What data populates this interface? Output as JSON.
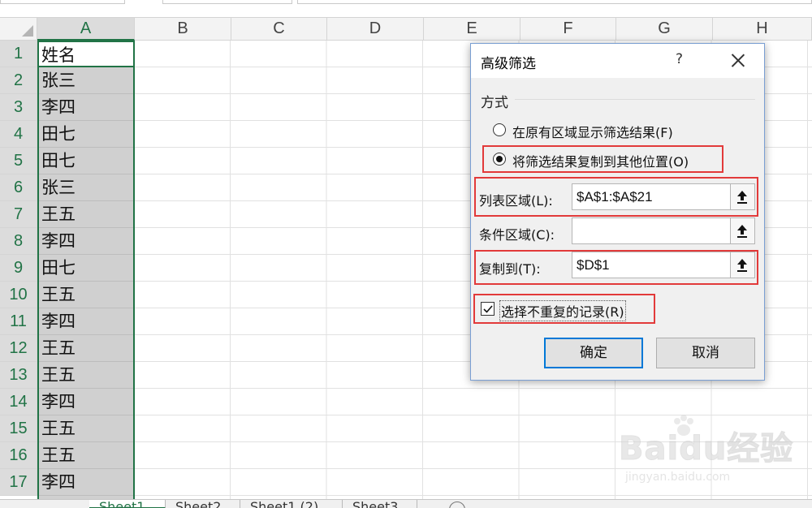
{
  "spreadsheet": {
    "columns": [
      "A",
      "B",
      "C",
      "D",
      "E",
      "F",
      "G",
      "H"
    ],
    "rows": [
      "1",
      "2",
      "3",
      "4",
      "5",
      "6",
      "7",
      "8",
      "9",
      "10",
      "11",
      "12",
      "13",
      "14",
      "15",
      "16",
      "17"
    ],
    "colA_values": [
      "姓名",
      "张三",
      "李四",
      "田七",
      "田七",
      "张三",
      "王五",
      "李四",
      "田七",
      "王五",
      "李四",
      "王五",
      "王五",
      "李四",
      "王五",
      "王五",
      "李四"
    ]
  },
  "sheet_tabs": [
    "Sheet1",
    "Sheet2",
    "Sheet1 (2)",
    "Sheet3"
  ],
  "dialog": {
    "title": "高级筛选",
    "help": "?",
    "group_label": "方式",
    "option_in_place": "在原有区域显示筛选结果(F)",
    "option_copy": "将筛选结果复制到其他位置(O)",
    "selected_option": "option_copy",
    "list_range_label": "列表区域(L):",
    "list_range_value": "$A$1:$A$21",
    "criteria_range_label": "条件区域(C):",
    "criteria_range_value": "",
    "copy_to_label": "复制到(T):",
    "copy_to_value": "$D$1",
    "unique_label": "选择不重复的记录(R)",
    "unique_checked": true,
    "ok_label": "确定",
    "cancel_label": "取消"
  },
  "watermark": {
    "brand": "Baidu经验",
    "url": "jingyan.baidu.com"
  },
  "colors": {
    "excel_green": "#217346",
    "highlight_red": "#e23a3a",
    "default_button_blue": "#0078d7"
  }
}
